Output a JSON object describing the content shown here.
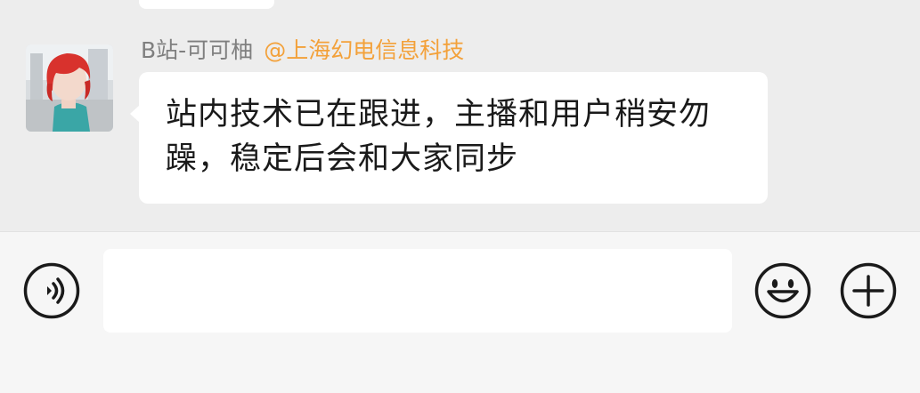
{
  "message": {
    "sender_name": "B站-可可柚",
    "mention": "@上海幻电信息科技",
    "text": "站内技术已在跟进，主播和用户稍安勿躁，稳定后会和大家同步"
  },
  "input_bar": {
    "value": "",
    "voice_icon": "voice-icon",
    "emoji_icon": "emoji-icon",
    "plus_icon": "plus-icon"
  },
  "colors": {
    "background": "#ededed",
    "bubble": "#ffffff",
    "mention": "#f3a13a",
    "sender_name": "#7f7f7f"
  }
}
